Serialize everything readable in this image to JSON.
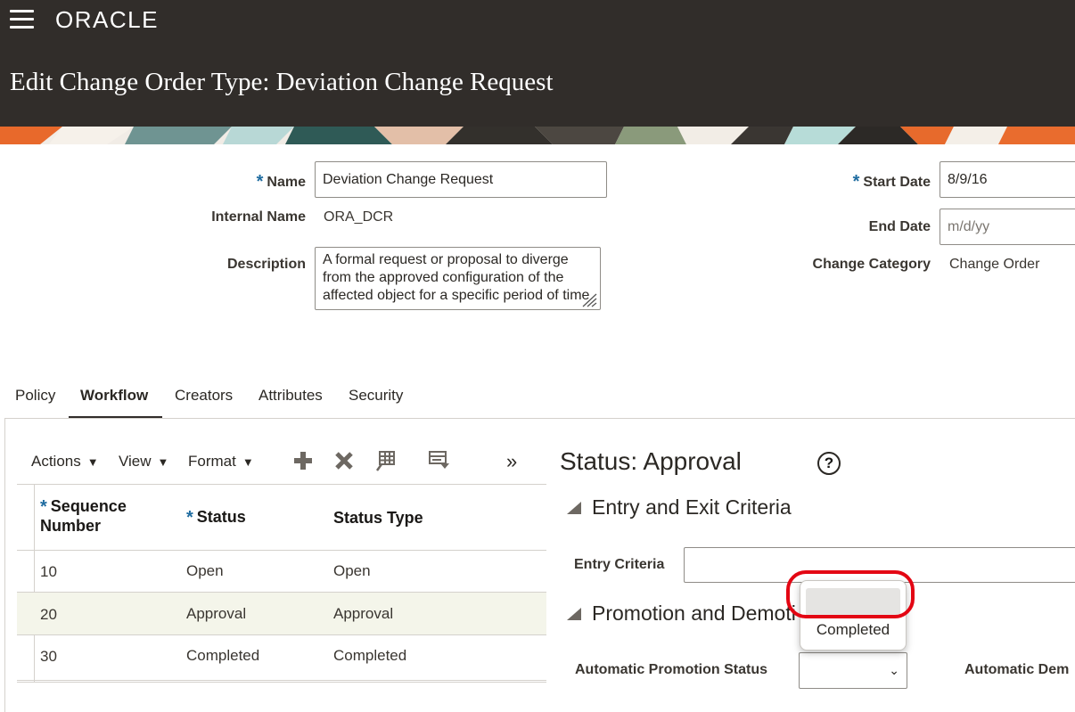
{
  "header": {
    "logo": "ORACLE",
    "title": "Edit Change Order Type: Deviation Change Request"
  },
  "form": {
    "name_label": "Name",
    "name_value": "Deviation Change Request",
    "internal_name_label": "Internal Name",
    "internal_name_value": "ORA_DCR",
    "description_label": "Description",
    "description_value": "A formal request or proposal to diverge from the approved configuration of the affected object for a specific period of time",
    "start_date_label": "Start Date",
    "start_date_value": "8/9/16",
    "end_date_label": "End Date",
    "end_date_placeholder": "m/d/yy",
    "change_category_label": "Change Category",
    "change_category_value": "Change Order"
  },
  "tabs": [
    {
      "label": "Policy"
    },
    {
      "label": "Workflow",
      "active": true
    },
    {
      "label": "Creators"
    },
    {
      "label": "Attributes"
    },
    {
      "label": "Security"
    }
  ],
  "toolbar": {
    "actions": "Actions",
    "view": "View",
    "format": "Format",
    "more": "»",
    "icons": [
      "add-icon",
      "delete-icon",
      "freeze-icon",
      "wrap-icon"
    ]
  },
  "table": {
    "headers": {
      "sequence_line1": "Sequence",
      "sequence_line2": "Number",
      "status": "Status",
      "status_type": "Status Type"
    },
    "rows": [
      {
        "sequence": "10",
        "status": "Open",
        "status_type": "Open"
      },
      {
        "sequence": "20",
        "status": "Approval",
        "status_type": "Approval",
        "selected": true
      },
      {
        "sequence": "30",
        "status": "Completed",
        "status_type": "Completed"
      }
    ]
  },
  "detail": {
    "title": "Status: Approval",
    "help": "?",
    "section1": "Entry and Exit Criteria",
    "entry_criteria_label": "Entry Criteria",
    "section2": "Promotion and Demoti",
    "auto_promotion_label": "Automatic Promotion Status",
    "auto_demotion_label": "Automatic Dem",
    "dropdown_options": [
      "",
      "Completed"
    ]
  },
  "colors": {
    "header_bg": "#312d2a",
    "required_asterisk": "#1f6ca0",
    "selected_row": "#f4f5ea",
    "highlight_ring": "#e30613"
  }
}
